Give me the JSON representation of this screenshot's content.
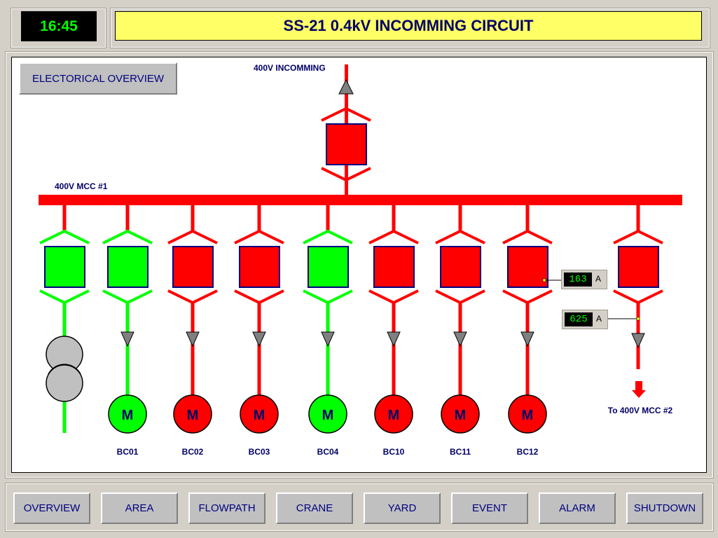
{
  "header": {
    "clock": "16:45",
    "title": "SS-21 0.4kV INCOMMING CIRCUIT"
  },
  "main": {
    "overview_button": "ELECTORICAL OVERVIEW",
    "incoming_label": "400V INCOMMING",
    "bus_label": "400V MCC #1",
    "outgoing_label": "To 400V MCC #2",
    "motor_symbol": "M",
    "incoming_state": "off",
    "feeders": [
      {
        "name": "",
        "type": "transformer",
        "state": "on"
      },
      {
        "name": "BC01",
        "type": "motor",
        "state": "on"
      },
      {
        "name": "BC02",
        "type": "motor",
        "state": "off"
      },
      {
        "name": "BC03",
        "type": "motor",
        "state": "off"
      },
      {
        "name": "BC04",
        "type": "motor",
        "state": "on"
      },
      {
        "name": "BC10",
        "type": "motor",
        "state": "off"
      },
      {
        "name": "BC11",
        "type": "motor",
        "state": "off"
      },
      {
        "name": "BC12",
        "type": "motor",
        "state": "off"
      },
      {
        "name": "",
        "type": "outgoing",
        "state": "off"
      }
    ],
    "meters": [
      {
        "value": "163",
        "unit": "A"
      },
      {
        "value": "625",
        "unit": "A"
      }
    ]
  },
  "colors": {
    "on": "#00ff00",
    "off": "#ff0000",
    "box_border": "#000080",
    "arrow": "#808080",
    "transformer": "#c0c0c0"
  },
  "nav": {
    "buttons": [
      "OVERVIEW",
      "AREA",
      "FLOWPATH",
      "CRANE",
      "YARD",
      "EVENT",
      "ALARM",
      "SHUTDOWN"
    ]
  }
}
